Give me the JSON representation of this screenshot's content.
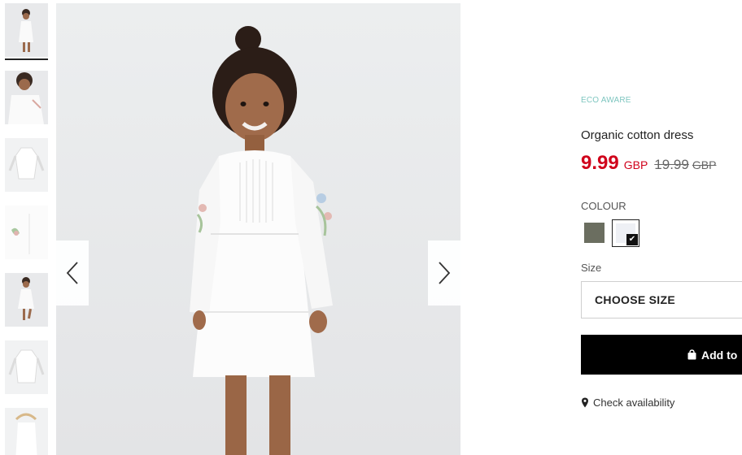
{
  "thumbnails": [
    {
      "alt": "girl-front-view",
      "selected": true
    },
    {
      "alt": "girl-closeup-view",
      "selected": false
    },
    {
      "alt": "dress-flat-front",
      "selected": false
    },
    {
      "alt": "sleeve-detail",
      "selected": false
    },
    {
      "alt": "girl-walking-view",
      "selected": false
    },
    {
      "alt": "dress-flat-back",
      "selected": false
    },
    {
      "alt": "dress-on-hanger",
      "selected": false
    }
  ],
  "gallery": {
    "prev_icon": "chevron-left-icon",
    "next_icon": "chevron-right-icon"
  },
  "product": {
    "badge": "ECO AWARE",
    "title": "Organic cotton dress",
    "price": "9.99",
    "currency": "GBP",
    "old_price": "19.99",
    "old_currency": "GBP"
  },
  "colour": {
    "label": "COLOUR",
    "options": [
      {
        "name": "khaki",
        "hex": "#6b6e60",
        "selected": false
      },
      {
        "name": "white",
        "hex": "#eef0f5",
        "selected": true
      }
    ]
  },
  "size": {
    "label": "Size",
    "placeholder": "CHOOSE SIZE"
  },
  "actions": {
    "add_label": "Add to",
    "add_icon": "shopping-bag-icon",
    "availability_label": "Check availability",
    "availability_icon": "location-pin-icon"
  },
  "colors": {
    "badge": "#7fc6c0",
    "price": "#d0021b",
    "button": "#000000"
  }
}
